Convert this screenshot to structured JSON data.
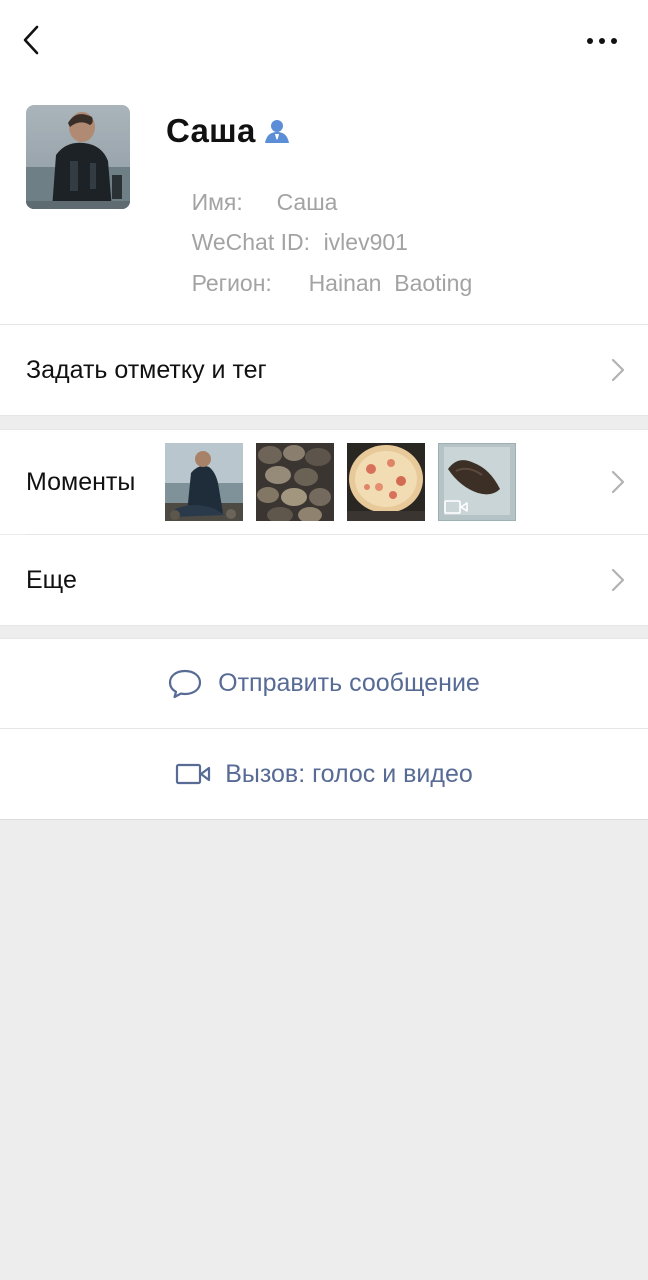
{
  "header": {
    "back_icon": "chevron-left-icon",
    "more_icon": "ellipsis-icon"
  },
  "profile": {
    "avatar_icon": "user-avatar-photo",
    "name": "Саша",
    "contact_badge_icon": "person-badge-icon",
    "badge_color": "#5b8ed6",
    "name_label": "Имя:",
    "name_value": "Саша",
    "wechat_label": "WeChat ID:",
    "wechat_value": "ivlev901",
    "region_label": "Регион:",
    "region_value": "Hainan  Baoting"
  },
  "menu": {
    "tag_label": "Задать отметку и тег",
    "moments_label": "Моменты",
    "more_label": "Еще"
  },
  "moments": {
    "thumbnails": [
      {
        "name": "moment-thumb-diver",
        "video": false
      },
      {
        "name": "moment-thumb-shells",
        "video": false
      },
      {
        "name": "moment-thumb-pizza",
        "video": false
      },
      {
        "name": "moment-thumb-video",
        "video": true
      }
    ]
  },
  "actions": {
    "message_label": "Отправить сообщение",
    "message_icon": "chat-bubble-icon",
    "call_label": "Вызов: голос и видео",
    "call_icon": "video-camera-icon",
    "accent_color": "#576b95"
  }
}
